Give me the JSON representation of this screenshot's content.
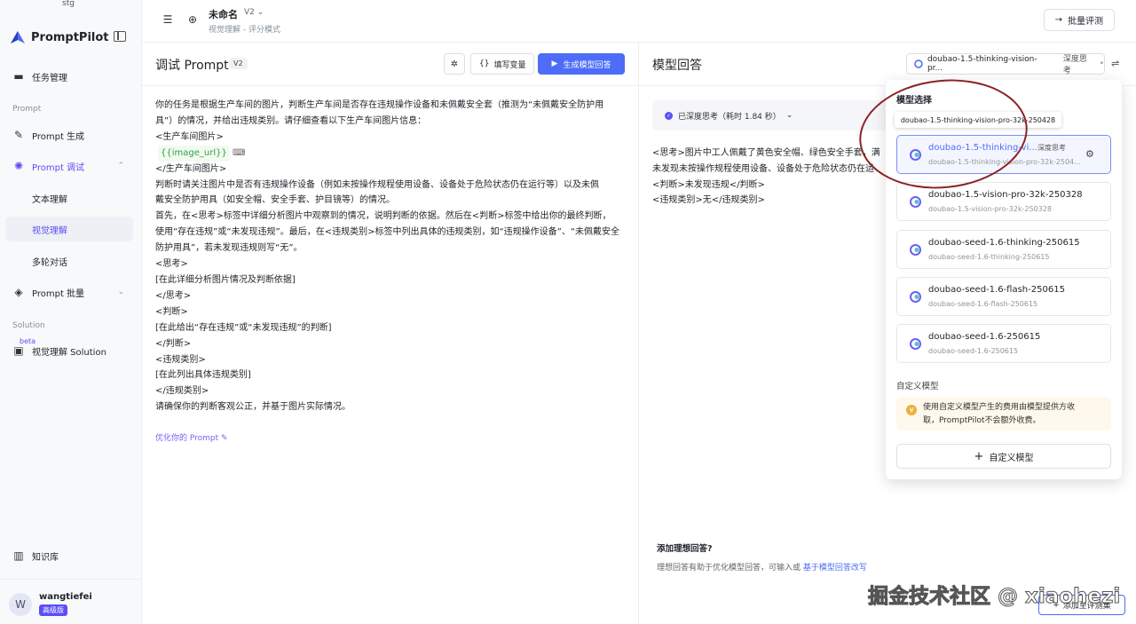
{
  "sidebar": {
    "env_label": "stg",
    "logo_text": "PromptPilot",
    "items": [
      {
        "label": "任务管理",
        "icon": "briefcase-icon"
      },
      {
        "label": "Prompt 生成",
        "icon": "wand-icon"
      },
      {
        "label": "Prompt 调试",
        "icon": "bug-icon"
      },
      {
        "label": "文本理解"
      },
      {
        "label": "视觉理解"
      },
      {
        "label": "多轮对话"
      },
      {
        "label": "Prompt 批量",
        "icon": "stack-icon"
      },
      {
        "label": "视觉理解 Solution",
        "icon": "box-icon"
      },
      {
        "label": "知识库",
        "icon": "book-icon"
      }
    ],
    "section_prompt": "Prompt",
    "section_solution": "Solution",
    "beta": "beta",
    "user": {
      "initial": "W",
      "name": "wangtiefei",
      "badge": "高级版"
    }
  },
  "header": {
    "title": "未命名",
    "version": "V2",
    "subtitle": "视觉理解 - 评分模式",
    "batch_eval": "批量评测"
  },
  "left": {
    "title": "调试 Prompt",
    "version": "V2",
    "fill_vars": "填写变量",
    "generate": "生成模型回答",
    "prompt_lines": [
      "你的任务是根据生产车间的图片，判断生产车间是否存在违规操作设备和未佩戴安全套（推测为“未佩戴安全防护用",
      "具”）的情况，并给出违规类别。请仔细查看以下生产车间图片信息：",
      "<生产车间图片>",
      "__VAR__",
      "</生产车间图片>",
      "判断时请关注图片中是否有违规操作设备（例如未按操作规程使用设备、设备处于危险状态仍在运行等）以及未佩",
      "戴安全防护用具（如安全帽、安全手套、护目镜等）的情况。",
      "首先，在<思考>标签中详细分析图片中观察到的情况，说明判断的依据。然后在<判断>标签中给出你的最终判断，",
      "使用“存在违规”或“未发现违规”。最后，在<违规类别>标签中列出具体的违规类别，如“违规操作设备”、“未佩戴安全",
      "防护用具”，若未发现违规则写“无”。",
      "<思考>",
      "[在此详细分析图片情况及判断依据]",
      "</思考>",
      "<判断>",
      "[在此给出“存在违规”或“未发现违规”的判断]",
      "</判断>",
      "<违规类别>",
      "[在此列出具体违规类别]",
      "</违规类别>",
      "请确保你的判断客观公正，并基于图片实际情况。"
    ],
    "variable": "{{image_url}}",
    "optimize": "优化你的 Prompt"
  },
  "right": {
    "title": "模型回答",
    "selected_model": "doubao-1.5-thinking-vision-pr...",
    "deep_think": "深度思考",
    "thinking_status": "已深度思考（耗时 1.84 秒）",
    "answer_lines": [
      "<思考>图片中工人佩戴了黄色安全帽、绿色安全手套，满",
      "未发现未按操作规程使用设备、设备处于危险状态仍在运",
      "<判断>未发现违规</判断>",
      "<违规类别>无</违规类别>"
    ],
    "add_ideal": "添加理想回答?",
    "add_desc": "理想回答有助于优化模型回答，可输入或 ",
    "add_link": "基于模型回答改写",
    "add_eval": "添加至评测集"
  },
  "dropdown": {
    "title": "模型选择",
    "tooltip": "doubao-1.5-thinking-vision-pro-32k-250428",
    "models": [
      {
        "name": "doubao-1.5-thinking-vi...",
        "id": "doubao-1.5-thinking-vision-pro-32k-2504...",
        "think": "深度思考"
      },
      {
        "name": "doubao-1.5-vision-pro-32k-250328",
        "id": "doubao-1.5-vision-pro-32k-250328"
      },
      {
        "name": "doubao-seed-1.6-thinking-250615",
        "id": "doubao-seed-1.6-thinking-250615"
      },
      {
        "name": "doubao-seed-1.6-flash-250615",
        "id": "doubao-seed-1.6-flash-250615"
      },
      {
        "name": "doubao-seed-1.6-250615",
        "id": "doubao-seed-1.6-250615"
      }
    ],
    "custom_label": "自定义模型",
    "notice_1": "使用自定义模型产生的费用由模型提供方收",
    "notice_2": "取，PromptPilot不会额外收费。",
    "custom_btn": "自定义模型"
  },
  "watermark": "掘金技术社区 @ xiaohezi",
  "colors": {
    "accent": "#4d6cf7",
    "brand": "#5b4ef5"
  }
}
